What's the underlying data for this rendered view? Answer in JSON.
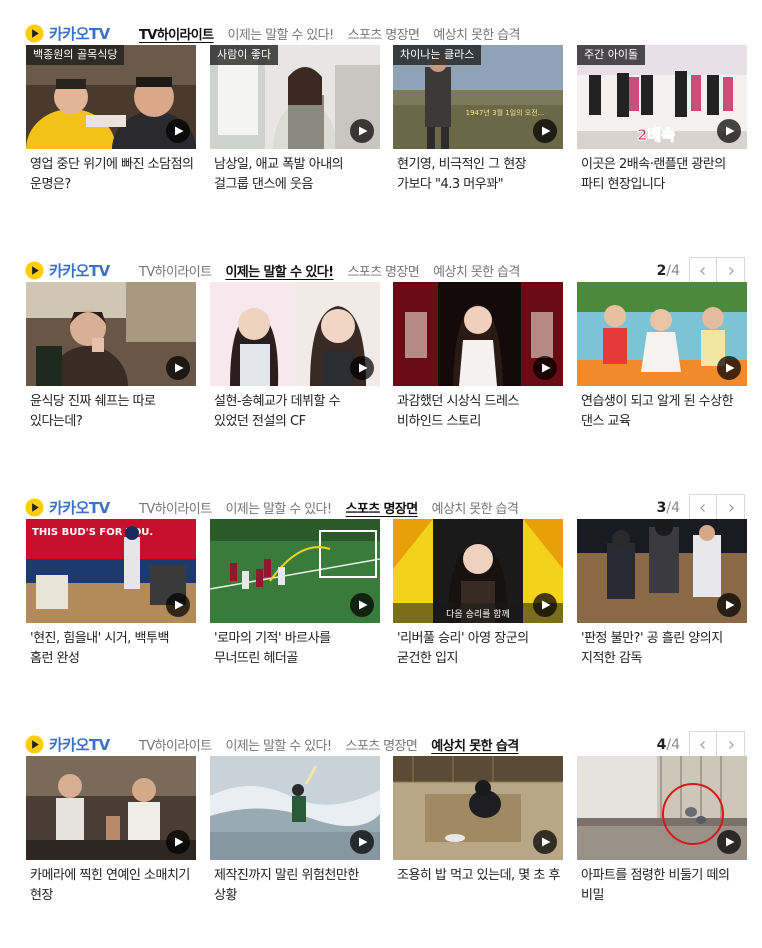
{
  "brand": {
    "name": "카카오TV",
    "color": "#3a72c8",
    "icon": "kakaotv-play-icon",
    "icon_color": "#ffcd00"
  },
  "tabs": [
    "TV하이라이트",
    "이제는 말할 수 있다!",
    "스포츠 명장면",
    "예상치 못한 습격"
  ],
  "sections": [
    {
      "active_tab": 0,
      "pager": null,
      "cards": [
        {
          "badge": "백종원의 골목식당",
          "title": "영업 중단 위기에 빠진 소담점의 운명은?"
        },
        {
          "badge": "사람이 좋다",
          "title": "남상일, 애교 폭발 아내의 걸그룹 댄스에 웃음"
        },
        {
          "badge": "차이나는 클라스",
          "title": "현기영, 비극적인 그 현장 가보다 \"4.3 머우꽈\""
        },
        {
          "badge": "주간 아이돌",
          "title": "이곳은 2배속·랜플댄 광란의 파티 현장입니다"
        }
      ]
    },
    {
      "active_tab": 1,
      "pager": {
        "current": "2",
        "total": "4"
      },
      "cards": [
        {
          "badge": "",
          "title": "윤식당 진짜 쉐프는 따로 있다는데?"
        },
        {
          "badge": "",
          "title": "설현-송혜교가 데뷔할 수 있었던 전설의 CF"
        },
        {
          "badge": "",
          "title": "과감했던 시상식 드레스 비하인드 스토리"
        },
        {
          "badge": "",
          "title": "연습생이 되고 알게 된 수상한 댄스 교육"
        }
      ]
    },
    {
      "active_tab": 2,
      "pager": {
        "current": "3",
        "total": "4"
      },
      "cards": [
        {
          "badge": "",
          "title": "'현진, 힘을내' 시거, 백투백 홈런 완성"
        },
        {
          "badge": "",
          "title": "'로마의 기적' 바르사를 무너뜨린 헤더골"
        },
        {
          "badge": "",
          "title": "'리버풀 승리' 아영 장군의 굳건한 입지"
        },
        {
          "badge": "",
          "title": "'판정 불만?' 공 흘린 양의지 지적한 감독"
        }
      ]
    },
    {
      "active_tab": 3,
      "pager": {
        "current": "4",
        "total": "4"
      },
      "cards": [
        {
          "badge": "",
          "title": "카메라에 찍힌 연예인 소매치기 현장"
        },
        {
          "badge": "",
          "title": "제작진까지 말린 위험천만한 상황"
        },
        {
          "badge": "",
          "title": "조용히 밥 먹고 있는데, 몇 초 후"
        },
        {
          "badge": "",
          "title": "아파트를 점령한 비둘기 떼의 비밀"
        }
      ]
    }
  ],
  "thumb_captions": {
    "s0c2": "1947년 3월 1일의 오전...",
    "s0c3": "2배속",
    "s2c0": "THIS BUD'S FOR YOU.",
    "s2c2": "다음 승리를 함께"
  }
}
